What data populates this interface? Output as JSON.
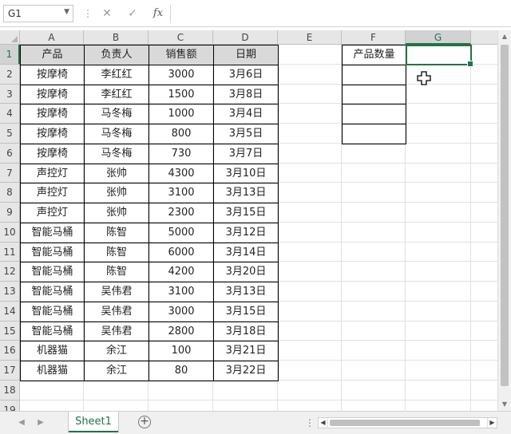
{
  "formula_bar": {
    "name_box": "G1",
    "cancel_icon": "✕",
    "enter_icon": "✓",
    "fx_label": "fx",
    "formula": ""
  },
  "columns": [
    "A",
    "B",
    "C",
    "D",
    "E",
    "F",
    "G"
  ],
  "rows": [
    "1",
    "2",
    "3",
    "4",
    "5",
    "6",
    "7",
    "8",
    "9",
    "10",
    "11",
    "12",
    "13",
    "14",
    "15",
    "16",
    "17",
    "18",
    "19"
  ],
  "table": {
    "headers": [
      "产品",
      "负责人",
      "销售额",
      "日期"
    ],
    "rows": [
      [
        "按摩椅",
        "李红红",
        "3000",
        "3月6日"
      ],
      [
        "按摩椅",
        "李红红",
        "1500",
        "3月8日"
      ],
      [
        "按摩椅",
        "马冬梅",
        "1000",
        "3月4日"
      ],
      [
        "按摩椅",
        "马冬梅",
        "800",
        "3月5日"
      ],
      [
        "按摩椅",
        "马冬梅",
        "730",
        "3月7日"
      ],
      [
        "声控灯",
        "张帅",
        "4300",
        "3月10日"
      ],
      [
        "声控灯",
        "张帅",
        "3100",
        "3月13日"
      ],
      [
        "声控灯",
        "张帅",
        "2300",
        "3月15日"
      ],
      [
        "智能马桶",
        "陈智",
        "5000",
        "3月12日"
      ],
      [
        "智能马桶",
        "陈智",
        "6000",
        "3月14日"
      ],
      [
        "智能马桶",
        "陈智",
        "4200",
        "3月20日"
      ],
      [
        "智能马桶",
        "吴伟君",
        "3100",
        "3月13日"
      ],
      [
        "智能马桶",
        "吴伟君",
        "3000",
        "3月15日"
      ],
      [
        "智能马桶",
        "吴伟君",
        "2800",
        "3月18日"
      ],
      [
        "机器猫",
        "余江",
        "100",
        "3月21日"
      ],
      [
        "机器猫",
        "余江",
        "80",
        "3月22日"
      ]
    ]
  },
  "side_table": {
    "header": "产品数量",
    "rows": [
      "",
      "",
      "",
      ""
    ]
  },
  "selected_cell": "G1",
  "sheet_tabs": [
    "Sheet1"
  ],
  "add_sheet_label": "+",
  "colors": {
    "accent": "#217346",
    "header_fill": "#d9d9d9"
  }
}
